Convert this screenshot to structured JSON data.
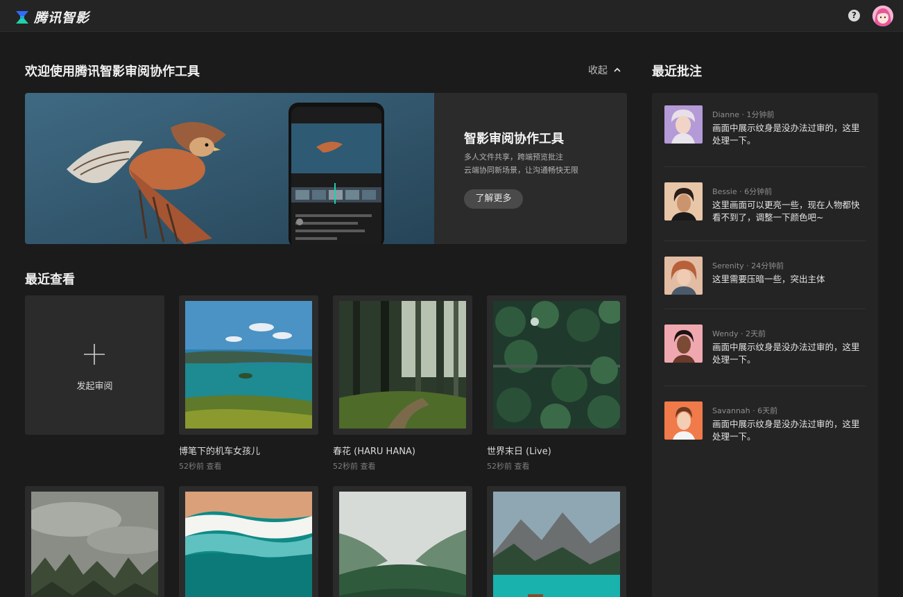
{
  "app": {
    "name": "腾讯智影",
    "help_icon": "help-circle-icon",
    "avatar_icon": "user-avatar"
  },
  "welcome": {
    "title": "欢迎使用腾讯智影审阅协作工具",
    "collapse_label": "收起",
    "banner_title": "智影审阅协作工具",
    "banner_line1": "多人文件共享，跨端预览批注",
    "banner_line2": "云端协同新场景，让沟通畅快无限",
    "learn_more_label": "了解更多"
  },
  "recent": {
    "title": "最近查看",
    "new_label": "发起审阅",
    "items": [
      {
        "title": "博笔下的机车女孩儿",
        "meta": "52秒前 查看"
      },
      {
        "title": "春花 (HARU HANA)",
        "meta": "52秒前 查看"
      },
      {
        "title": "世界末日 (Live)",
        "meta": "52秒前 查看"
      }
    ]
  },
  "comments": {
    "title": "最近批注",
    "items": [
      {
        "meta": "Dianne · 1分钟前",
        "text": "画面中展示纹身是没办法过审的，这里处理一下。"
      },
      {
        "meta": "Bessie · 6分钟前",
        "text": "这里画面可以更亮一些，现在人物都快看不到了，调整一下颜色吧~"
      },
      {
        "meta": "Serenity · 24分钟前",
        "text": "这里需要压暗一些，突出主体"
      },
      {
        "meta": "Wendy · 2天前",
        "text": "画面中展示纹身是没办法过审的，这里处理一下。"
      },
      {
        "meta": "Savannah · 6天前",
        "text": "画面中展示纹身是没办法过审的，这里处理一下。"
      }
    ]
  },
  "colors": {
    "background": "#1b1b1c",
    "panel": "#242425",
    "card": "#2b2b2c",
    "accent": "#1ed1a8"
  }
}
